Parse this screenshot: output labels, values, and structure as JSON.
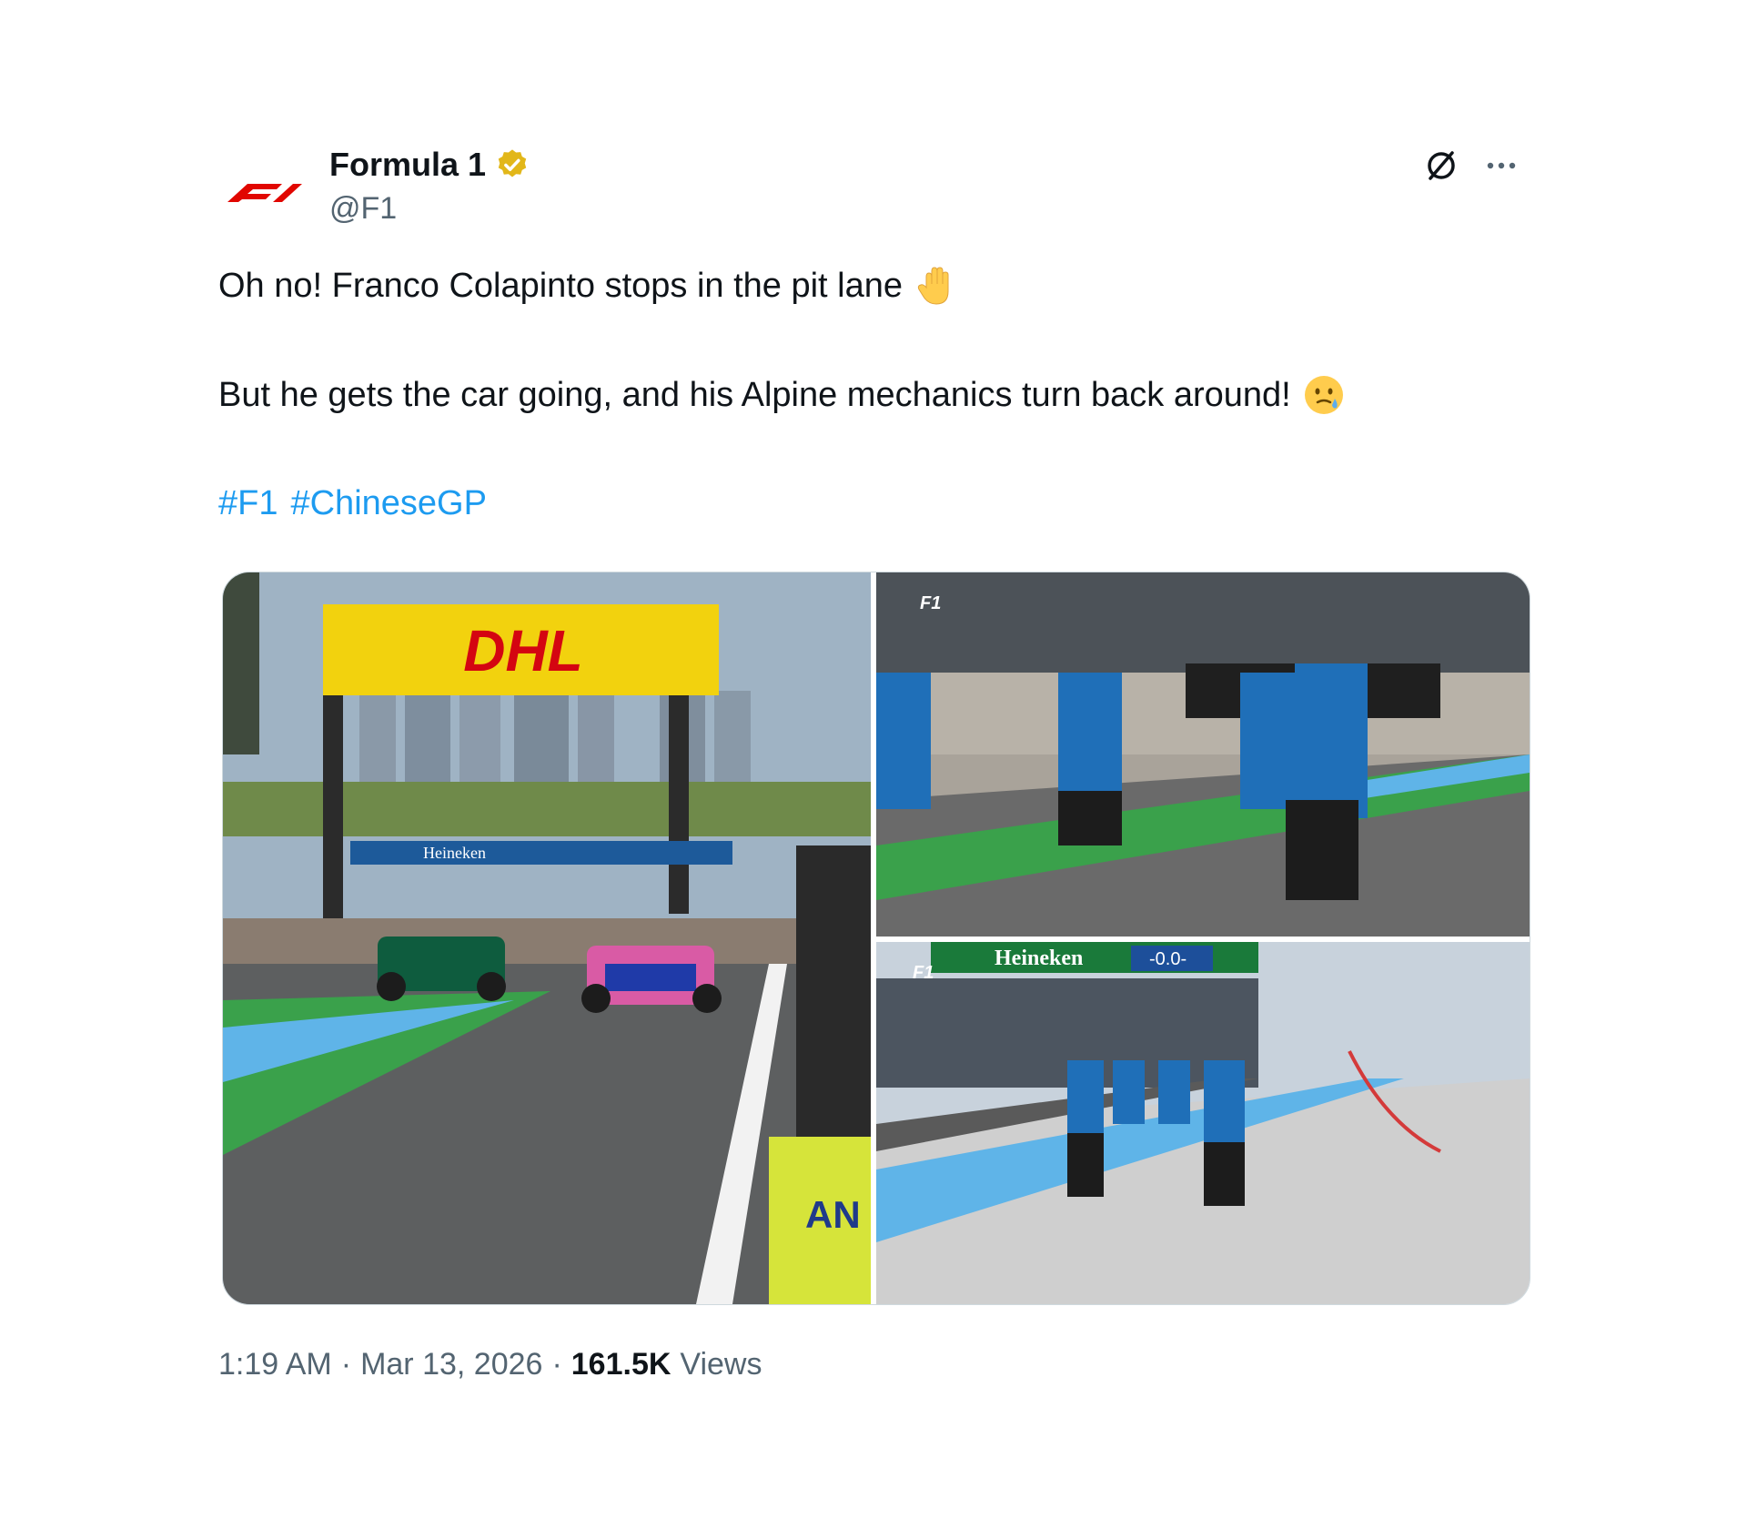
{
  "account": {
    "display_name": "Formula 1",
    "handle": "@F1",
    "verified_badge": "gold-verified-icon",
    "avatar_icon": "f1-logo-icon"
  },
  "tweet": {
    "line1": "Oh no! Franco Colapinto stops in the pit lane",
    "line1_emoji": "raised-hand-emoji",
    "line2": "But he gets the car going, and his Alpine mechanics turn back around!",
    "line2_emoji": "smiling-face-with-tear-emoji",
    "hashtags": [
      "#F1",
      "#ChineseGP"
    ]
  },
  "media": {
    "left_sign": "DHL",
    "left_banner": "Heineken",
    "left_board": "AN",
    "bottom_banner": "Heineken",
    "bottom_banner_score": "-0.0-"
  },
  "footer": {
    "time": "1:19 AM",
    "separator": "·",
    "date": "Mar 13, 2026",
    "views_count": "161.5K",
    "views_label": "Views"
  },
  "colors": {
    "hashtag": "#1d9bf0",
    "f1_red": "#e10600",
    "verified_gold": "#e2b719",
    "muted_text": "#536471"
  }
}
